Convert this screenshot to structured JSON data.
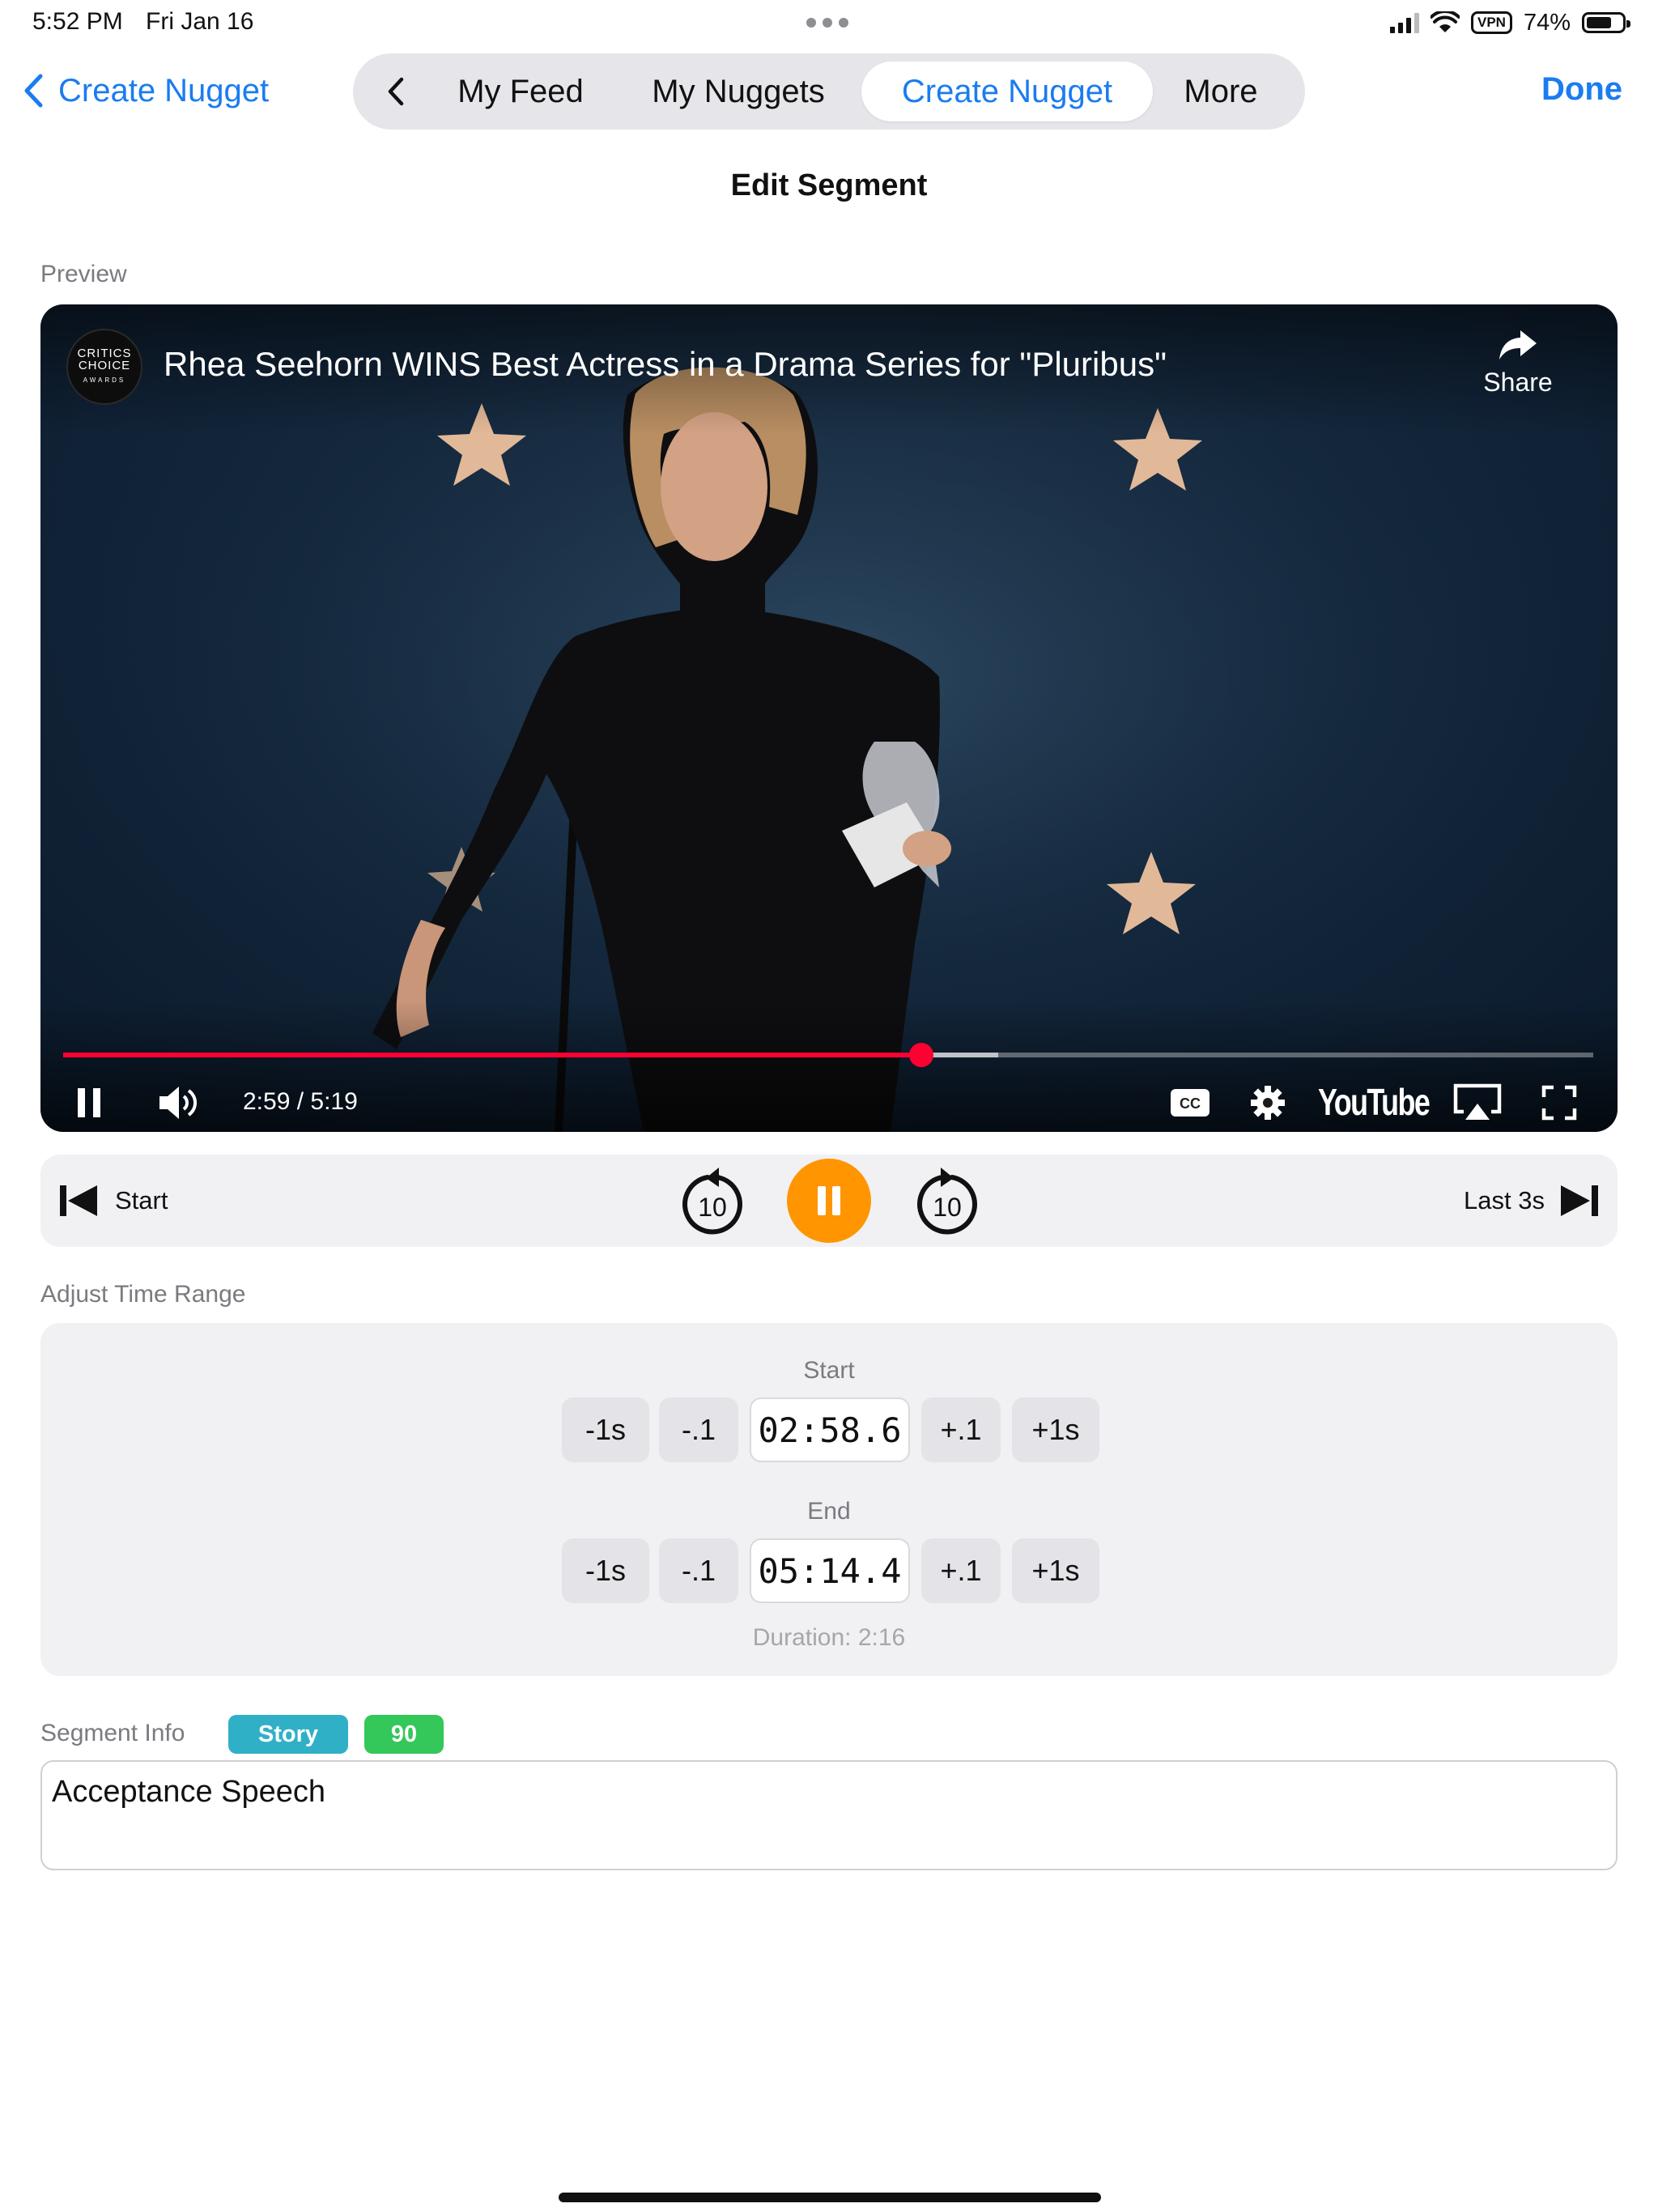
{
  "status_bar": {
    "time": "5:52 PM",
    "date": "Fri Jan 16",
    "vpn_label": "VPN",
    "battery": "74%",
    "battery_level": 0.74
  },
  "nav": {
    "back_label": "Create Nugget",
    "tabs": [
      {
        "label": "My Feed",
        "active": false
      },
      {
        "label": "My Nuggets",
        "active": false
      },
      {
        "label": "Create Nugget",
        "active": true
      },
      {
        "label": "More",
        "active": false
      }
    ],
    "done_label": "Done",
    "accent_color": "#1a7cf0"
  },
  "page_title": "Edit Segment",
  "preview": {
    "section_label": "Preview",
    "channel_logo_text": "CRITICS CHOICE",
    "channel_logo_sub": "AWARDS",
    "video_title": "Rhea Seehorn WINS Best Actress in a Drama Series for \"Pluribus\"",
    "share_label": "Share",
    "current_time": "2:59",
    "total_time": "5:19",
    "time_display": "2:59 / 5:19",
    "played_fraction": 0.561,
    "buffered_fraction": 0.611,
    "brand": "YouTube",
    "progress_color": "#ff0033",
    "icons": [
      "pause-icon",
      "volume-icon",
      "captions-icon",
      "settings-icon",
      "airplay-icon",
      "fullscreen-icon",
      "share-icon"
    ]
  },
  "transport": {
    "start_label": "Start",
    "last_label": "Last 3s",
    "skip_back_seconds": "10",
    "skip_forward_seconds": "10",
    "play_color": "#ff9500"
  },
  "range": {
    "section_label": "Adjust Time Range",
    "start": {
      "label": "Start",
      "value": "02:58.6",
      "buttons": [
        "-1s",
        "-.1",
        "+.1",
        "+1s"
      ]
    },
    "end": {
      "label": "End",
      "value": "05:14.4",
      "buttons": [
        "-1s",
        "-.1",
        "+.1",
        "+1s"
      ]
    },
    "duration": "Duration: 2:16"
  },
  "segment_info": {
    "section_label": "Segment Info",
    "badges": [
      {
        "label": "Story",
        "color": "#30b0c7"
      },
      {
        "label": "90",
        "color": "#34c759"
      }
    ],
    "text_value": "Acceptance Speech"
  }
}
